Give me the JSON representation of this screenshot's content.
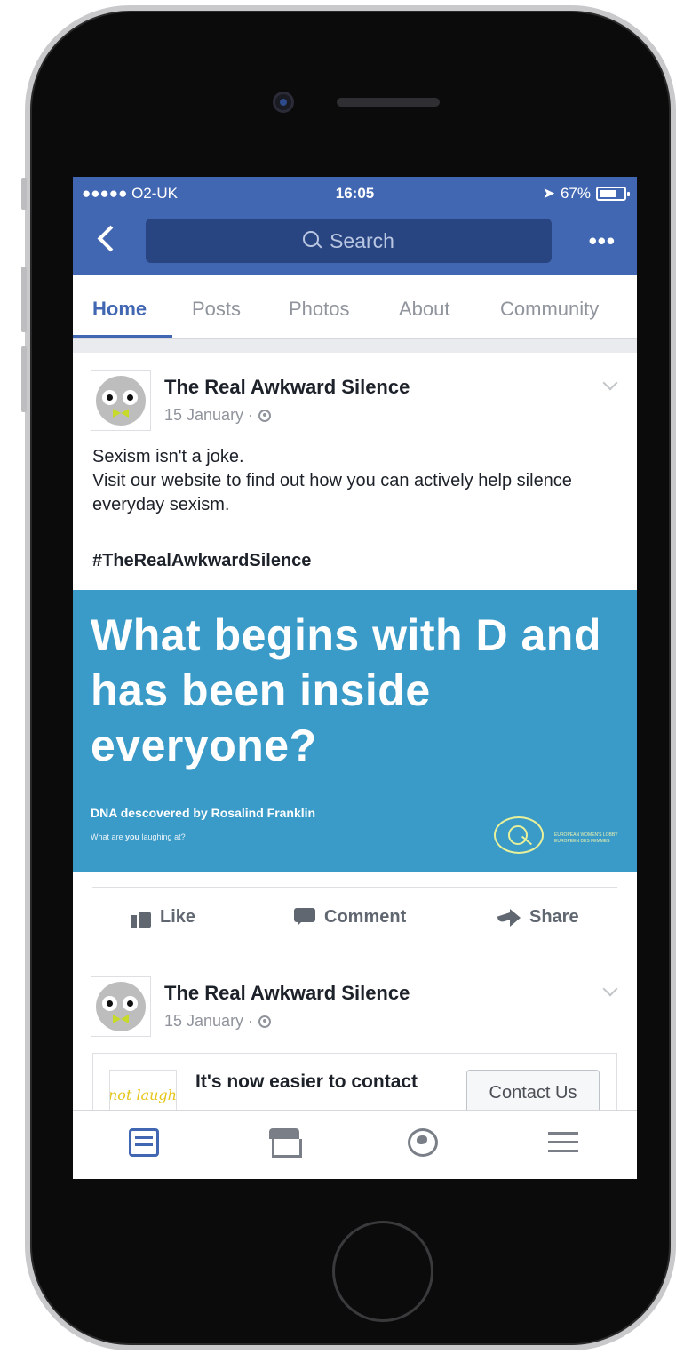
{
  "status_bar": {
    "carrier": "●●●●● O2-UK",
    "time": "16:05",
    "battery": "67%"
  },
  "nav": {
    "search_placeholder": "Search",
    "more": "•••"
  },
  "tabs": [
    "Home",
    "Posts",
    "Photos",
    "About",
    "Community"
  ],
  "posts": [
    {
      "author": "The Real Awkward Silence",
      "date": "15 January ·",
      "text_line1": "Sexism isn't a joke.",
      "text_line2": "Visit our website to find out how you can actively help silence everyday sexism.",
      "hashtag": "#TheRealAwkwardSilence",
      "image": {
        "headline": "What begins with D and has been inside everyone?",
        "subline": "DNA descovered by Rosalind Franklin",
        "footer_prefix": "What are ",
        "footer_bold": "you",
        "footer_suffix": " laughing at?",
        "logo_text": "EUROPEAN WOMEN'S LOBBY EUROPEEN DES FEMMES"
      },
      "actions": {
        "like": "Like",
        "comment": "Comment",
        "share": "Share"
      }
    },
    {
      "author": "The Real Awkward Silence",
      "date": "15 January ·",
      "preview_thumb_text": "not laughi",
      "preview_title": "It's now easier to contact",
      "contact_button": "Contact Us"
    }
  ],
  "colors": {
    "brand": "#4267b2",
    "ad_background": "#3a9bc8",
    "feed_background": "#e9ebee"
  }
}
